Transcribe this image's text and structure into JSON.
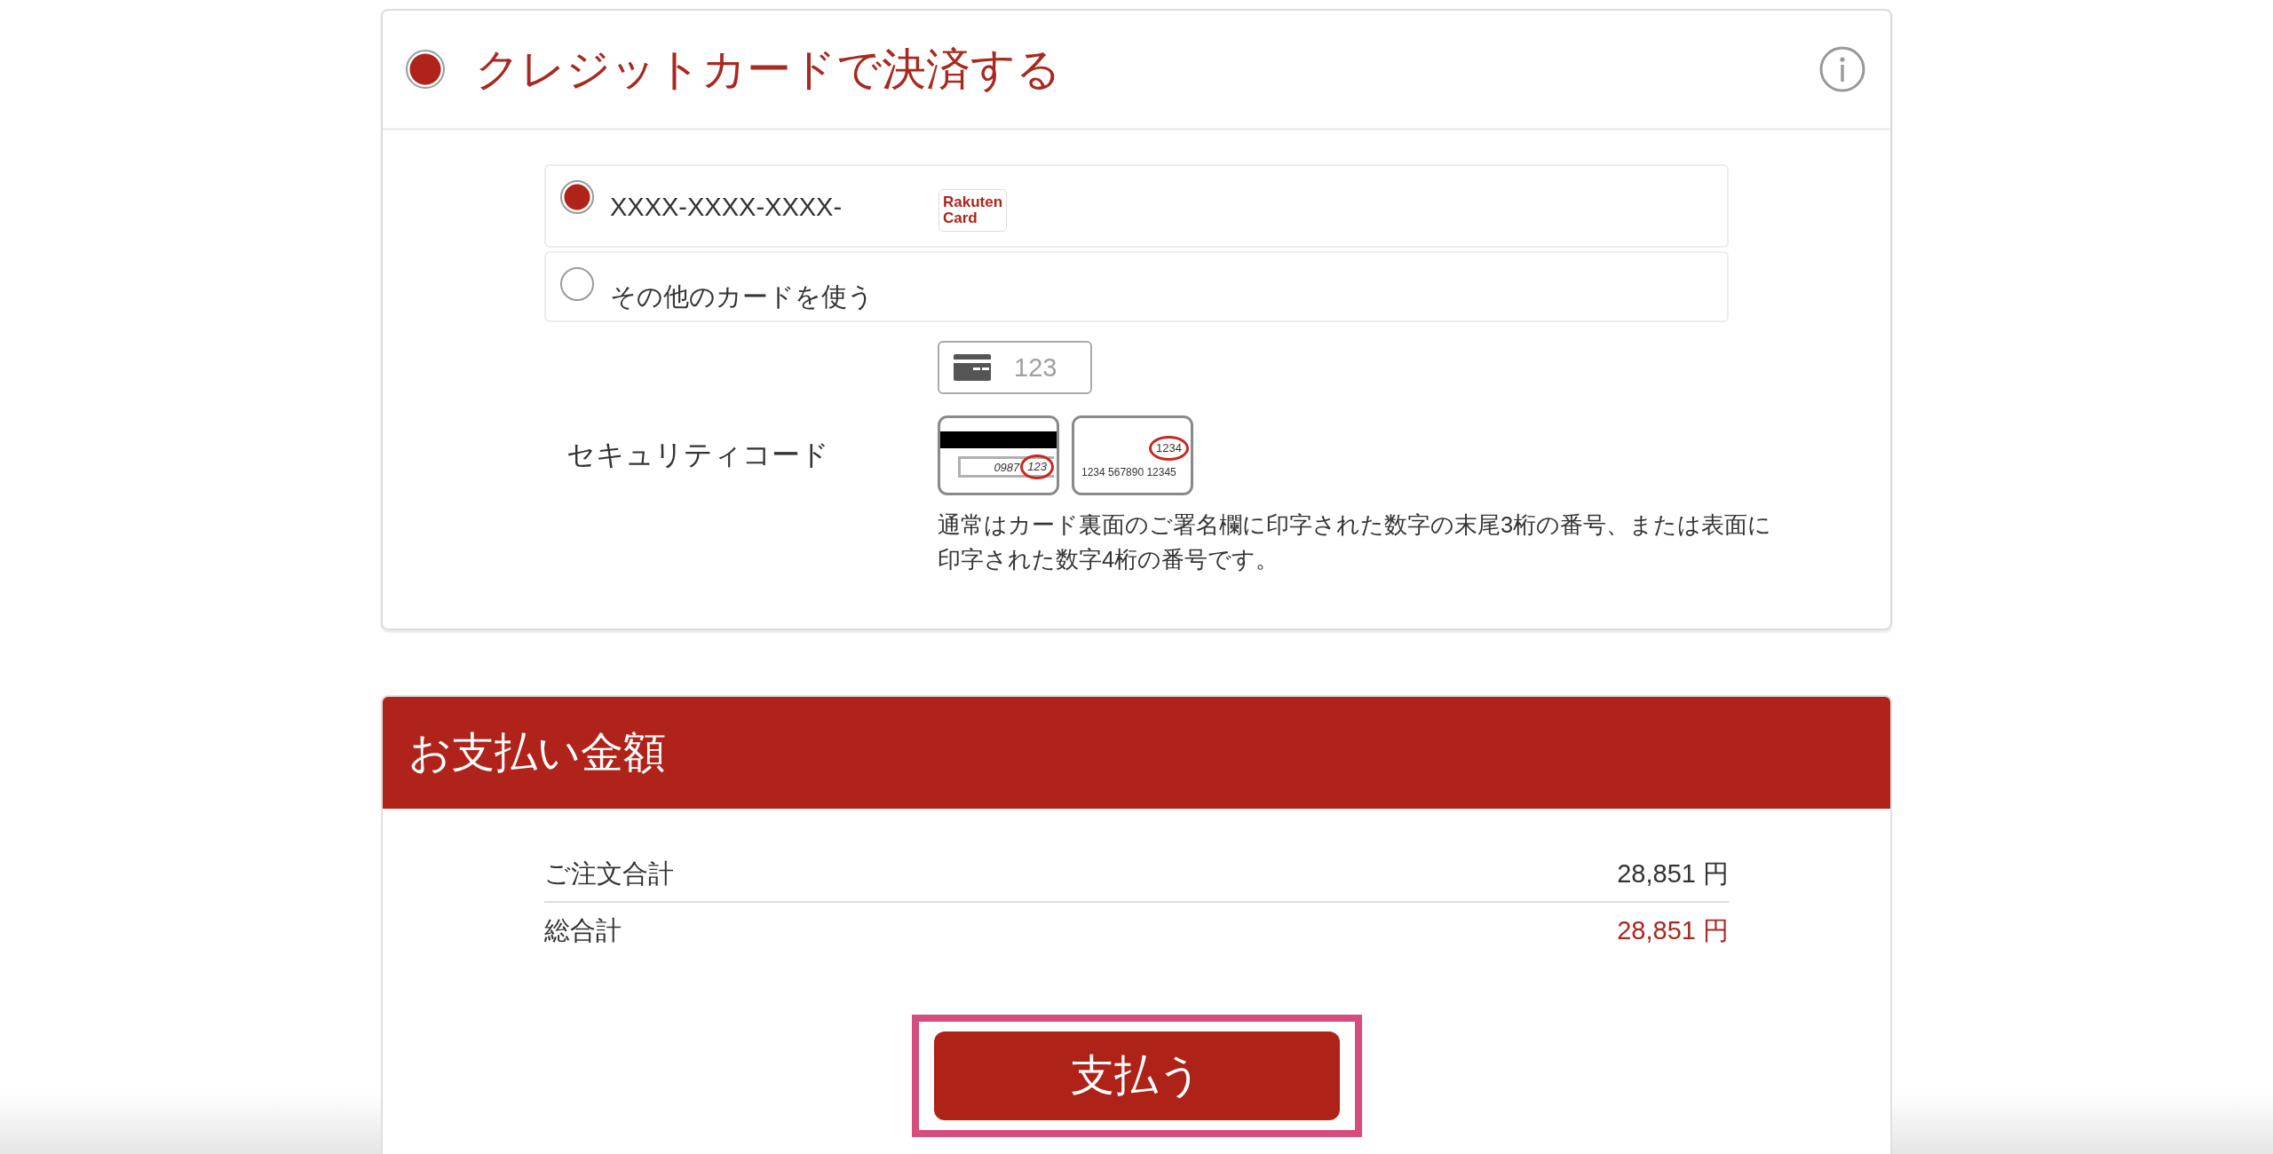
{
  "payment_method": {
    "label": "クレジットカードで決済する",
    "selected": true
  },
  "saved_cards": [
    {
      "kind": "saved",
      "number": "XXXX-XXXX-XXXX-",
      "brand": "Rakuten Card",
      "selected": true
    },
    {
      "kind": "other",
      "label": "その他のカードを使う",
      "selected": false
    }
  ],
  "security_code": {
    "label": "セキュリティコード",
    "placeholder": "123",
    "back_card": {
      "panel_digits": "0987",
      "code": "123"
    },
    "front_card": {
      "code": "1234",
      "number": "1234 567890 12345"
    },
    "help": "通常はカード裏面のご署名欄に印字された数字の末尾3桁の番号、または表面に印字された数字4桁の番号です。"
  },
  "payment_summary": {
    "title": "お支払い金額",
    "rows": [
      {
        "kind": "subtotal",
        "label": "ご注文合計",
        "amount": "28,851 円"
      },
      {
        "kind": "total",
        "label": "総合計",
        "amount": "28,851 円"
      }
    ]
  },
  "pay_button": {
    "label": "支払う",
    "highlighted": true
  }
}
